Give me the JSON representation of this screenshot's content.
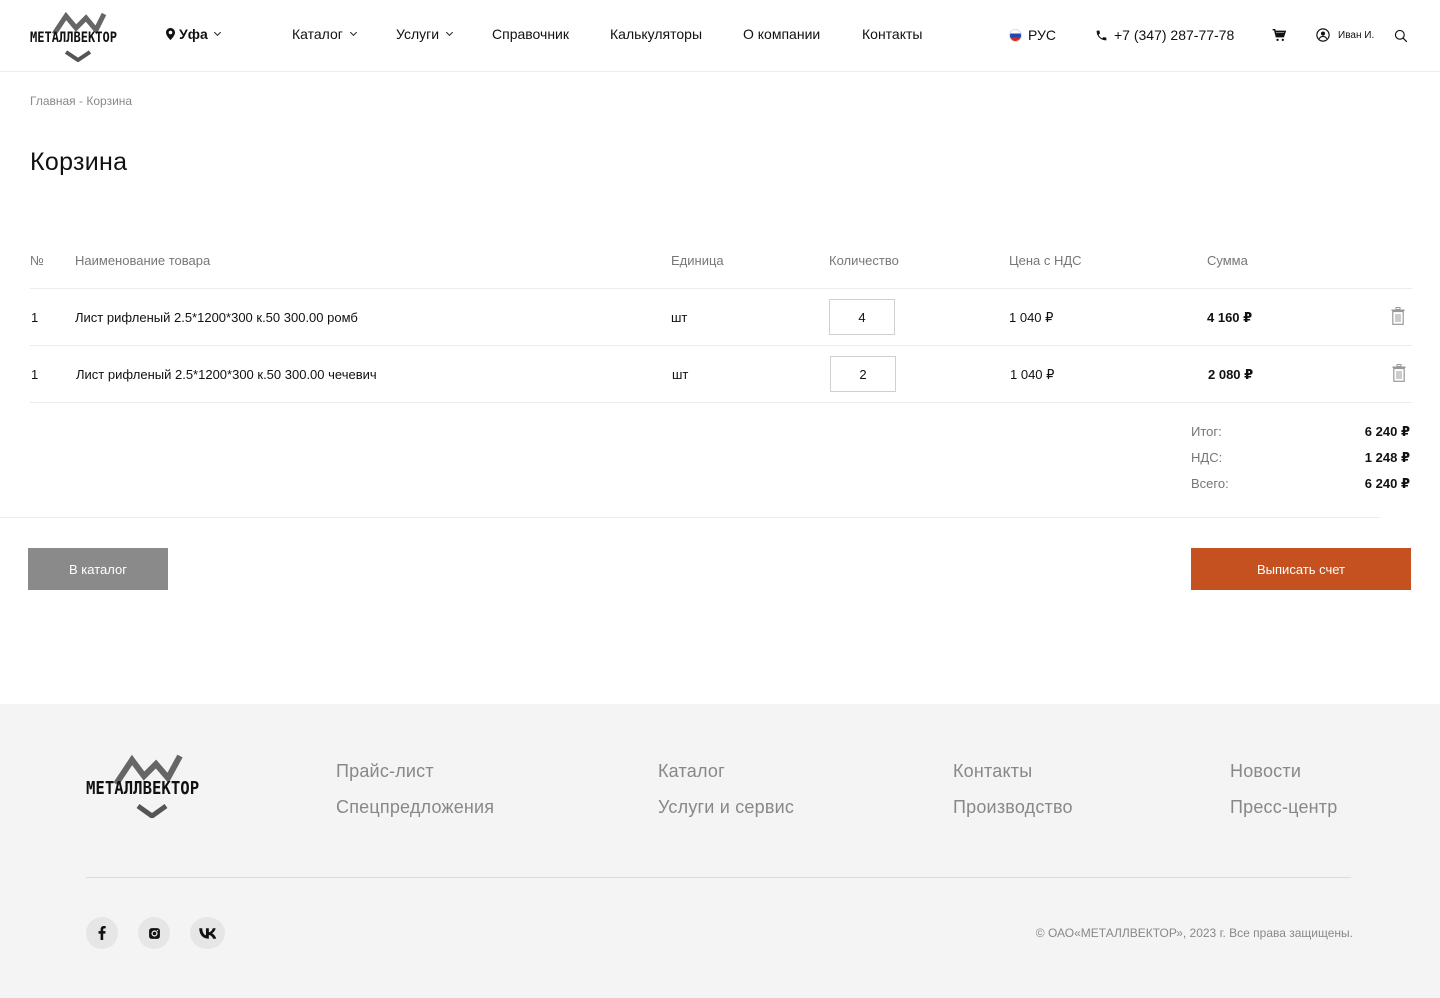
{
  "header": {
    "logo_text": "МЕТАЛЛВЕКТОР",
    "city": "Уфа",
    "nav": [
      {
        "label": "Каталог",
        "dropdown": true
      },
      {
        "label": "Услуги",
        "dropdown": true
      },
      {
        "label": "Справочник",
        "dropdown": false
      },
      {
        "label": "Калькуляторы",
        "dropdown": false
      },
      {
        "label": "О компании",
        "dropdown": false
      },
      {
        "label": "Контакты",
        "dropdown": false
      }
    ],
    "language": "РУС",
    "phone": "+7 (347) 287-77-78",
    "user_name": "Иван И."
  },
  "breadcrumb": {
    "home": "Главная",
    "separator": " - ",
    "current": "Корзина"
  },
  "page_title": "Корзина",
  "table": {
    "headers": {
      "num": "№",
      "name": "Наименование товара",
      "unit": "Единица",
      "qty": "Количество",
      "price": "Цена с НДС",
      "sum": "Сумма"
    },
    "rows": [
      {
        "num": "1",
        "name": "Лист рифленый 2.5*1200*300 к.50 300.00 ромб",
        "unit": "шт",
        "qty": "4",
        "price": "1 040 ₽",
        "sum": "4 160 ₽"
      },
      {
        "num": "1",
        "name": "Лист рифленый 2.5*1200*300 к.50 300.00 чечевич",
        "unit": "шт",
        "qty": "2",
        "price": "1 040 ₽",
        "sum": "2 080 ₽"
      }
    ]
  },
  "totals": {
    "subtotal_label": "Итог:",
    "subtotal": "6 240 ₽",
    "vat_label": "НДС:",
    "vat": "1 248 ₽",
    "total_label": "Всего:",
    "total": "6 240 ₽"
  },
  "buttons": {
    "catalog": "В каталог",
    "invoice": "Выписать счет"
  },
  "colors": {
    "accent": "#c4511f",
    "secondary_button": "#8a8a8a",
    "footer_bg": "#f4f4f4"
  },
  "footer": {
    "logo_text": "МЕТАЛЛВЕКТОР",
    "links": [
      "Прайс-лист",
      "Спецпредложения",
      "Каталог",
      "Услуги и сервис",
      "Контакты",
      "Производство",
      "Новости",
      "Пресс-центр"
    ],
    "social": [
      "facebook-icon",
      "instagram-icon",
      "vk-icon"
    ],
    "copyright": "© ОАО«МЕТАЛЛВЕКТОР», 2023 г. Все права защищены."
  }
}
